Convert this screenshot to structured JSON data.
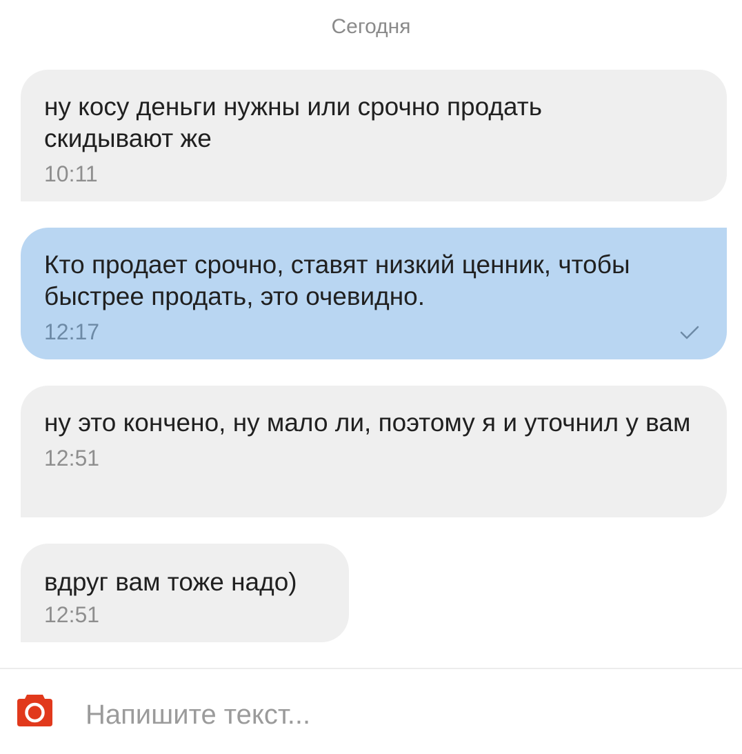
{
  "chat": {
    "date_label": "Сегодня",
    "messages": [
      {
        "direction": "in",
        "text": "ну косу деньги нужны или срочно продать скидывают же",
        "time": "10:11"
      },
      {
        "direction": "out",
        "text": "Кто продает срочно, ставят низкий ценник, чтобы быстрее продать, это очевидно.",
        "time": "12:17",
        "status": "sent-check"
      },
      {
        "direction": "in",
        "text": "ну это кончено, ну мало ли, поэтому я и уточнил у вам",
        "time": "12:51"
      },
      {
        "direction": "in",
        "text": "вдруг вам тоже надо)",
        "time": "12:51"
      }
    ]
  },
  "composer": {
    "placeholder": "Напишите текст...",
    "camera_icon": "camera-icon"
  },
  "colors": {
    "incoming_bubble": "#efefef",
    "outgoing_bubble": "#b9d6f2",
    "camera_accent": "#e1391c"
  }
}
